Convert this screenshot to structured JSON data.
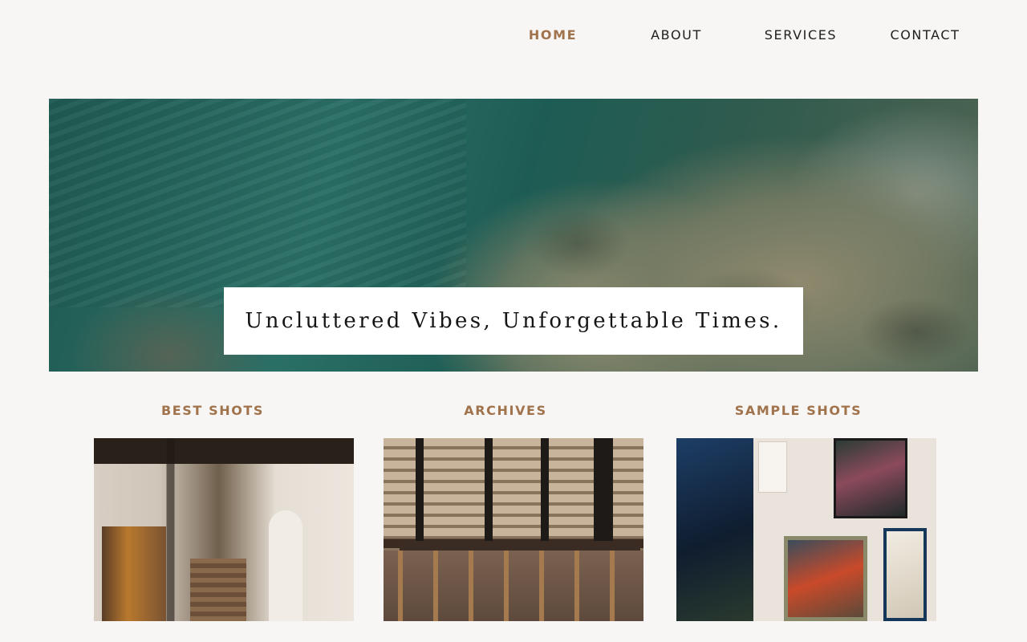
{
  "nav": {
    "items": [
      {
        "label": "HOME",
        "active": true
      },
      {
        "label": "ABOUT",
        "active": false
      },
      {
        "label": "SERVICES",
        "active": false
      },
      {
        "label": "CONTACT",
        "active": false
      }
    ]
  },
  "hero": {
    "tagline": "Uncluttered Vibes, Unforgettable Times."
  },
  "gallery": {
    "sections": [
      {
        "title": "BEST SHOTS"
      },
      {
        "title": "ARCHIVES"
      },
      {
        "title": "SAMPLE SHOTS"
      }
    ]
  },
  "colors": {
    "accent": "#a0734c",
    "background": "#f7f6f4",
    "text": "#1e1e1e"
  }
}
